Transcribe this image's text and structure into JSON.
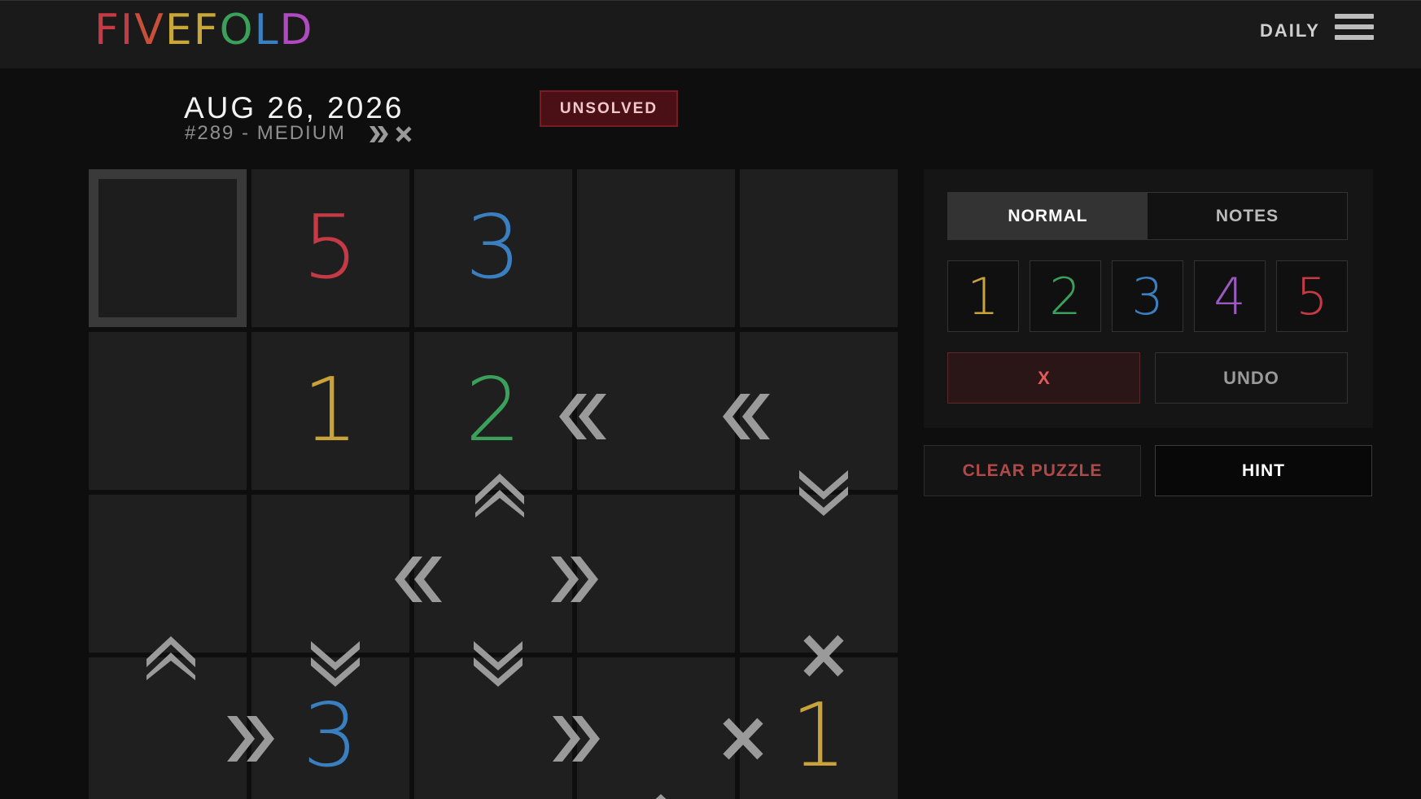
{
  "header": {
    "logo_letters": [
      "F",
      "I",
      "V",
      "E",
      "F",
      "O",
      "L",
      "D"
    ],
    "logo_colors": [
      "#c63a46",
      "#c63a46",
      "#c8503a",
      "#c9a63a",
      "#c9a63a",
      "#3aa05a",
      "#3a80c0",
      "#b04ac0"
    ],
    "daily_label": "DAILY"
  },
  "puzzle": {
    "date": "AUG 26, 2026",
    "subtitle": "#289 - MEDIUM",
    "status": "UNSOLVED"
  },
  "board": {
    "cells": [
      {
        "row": 0,
        "col": 0,
        "value": "",
        "selected": true
      },
      {
        "row": 0,
        "col": 1,
        "value": "5"
      },
      {
        "row": 0,
        "col": 2,
        "value": "3"
      },
      {
        "row": 0,
        "col": 3,
        "value": ""
      },
      {
        "row": 0,
        "col": 4,
        "value": ""
      },
      {
        "row": 1,
        "col": 0,
        "value": ""
      },
      {
        "row": 1,
        "col": 1,
        "value": "1"
      },
      {
        "row": 1,
        "col": 2,
        "value": "2"
      },
      {
        "row": 1,
        "col": 3,
        "value": ""
      },
      {
        "row": 1,
        "col": 4,
        "value": ""
      },
      {
        "row": 2,
        "col": 0,
        "value": ""
      },
      {
        "row": 2,
        "col": 1,
        "value": ""
      },
      {
        "row": 2,
        "col": 2,
        "value": ""
      },
      {
        "row": 2,
        "col": 3,
        "value": ""
      },
      {
        "row": 2,
        "col": 4,
        "value": ""
      },
      {
        "row": 3,
        "col": 0,
        "value": ""
      },
      {
        "row": 3,
        "col": 1,
        "value": "3"
      },
      {
        "row": 3,
        "col": 2,
        "value": ""
      },
      {
        "row": 3,
        "col": 3,
        "value": ""
      },
      {
        "row": 3,
        "col": 4,
        "value": "1"
      }
    ],
    "digit_colors": {
      "1": "#c9a23a",
      "2": "#3aa05a",
      "3": "#3a7fc0",
      "4": "#9a5ac0",
      "5": "#c63a46"
    },
    "clue_icon_color": "#9a9a9a"
  },
  "controls": {
    "mode_normal": "NORMAL",
    "mode_notes": "NOTES",
    "numbers": [
      "1",
      "2",
      "3",
      "4",
      "5"
    ],
    "clear_cell": "X",
    "undo": "UNDO",
    "clear_puzzle": "CLEAR PUZZLE",
    "hint": "HINT"
  }
}
